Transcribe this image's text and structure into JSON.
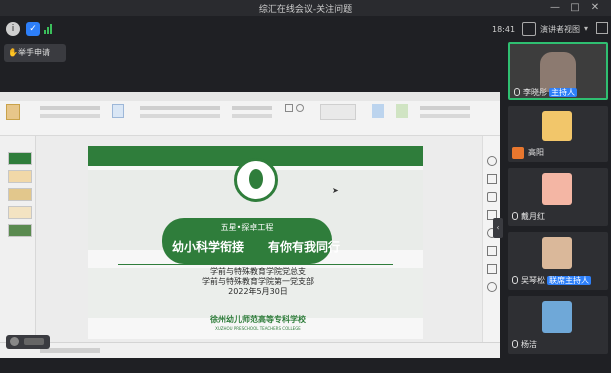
{
  "window": {
    "title": "综汇在线会议-关注问题"
  },
  "toolbar": {
    "time": "18:41",
    "view_label": "演讲者视图"
  },
  "raise_hand": {
    "label": "举手申请"
  },
  "slide": {
    "subtitle": "五星•探卓工程",
    "title_left": "幼小科学衔接",
    "title_right": "有你有我同行",
    "org_line1": "学前与特殊教育学院党总支",
    "org_line2": "学前与特殊教育学院第一党支部",
    "date": "2022年5月30日",
    "footer_cn": "徐州幼儿师范高等专科学校",
    "footer_en": "XUZHOU PRESCHOOL TEACHERS COLLEGE"
  },
  "participants": [
    {
      "name": "李晓彤",
      "tag": "主持人"
    },
    {
      "name": "高阳",
      "tag": ""
    },
    {
      "name": "戴月红",
      "tag": ""
    },
    {
      "name": "吴琴松",
      "tag": "联席主持人"
    },
    {
      "name": "杨洁",
      "tag": ""
    }
  ],
  "colors": {
    "brand_green": "#2f7d3b",
    "tag_blue": "#2d7ff9"
  }
}
